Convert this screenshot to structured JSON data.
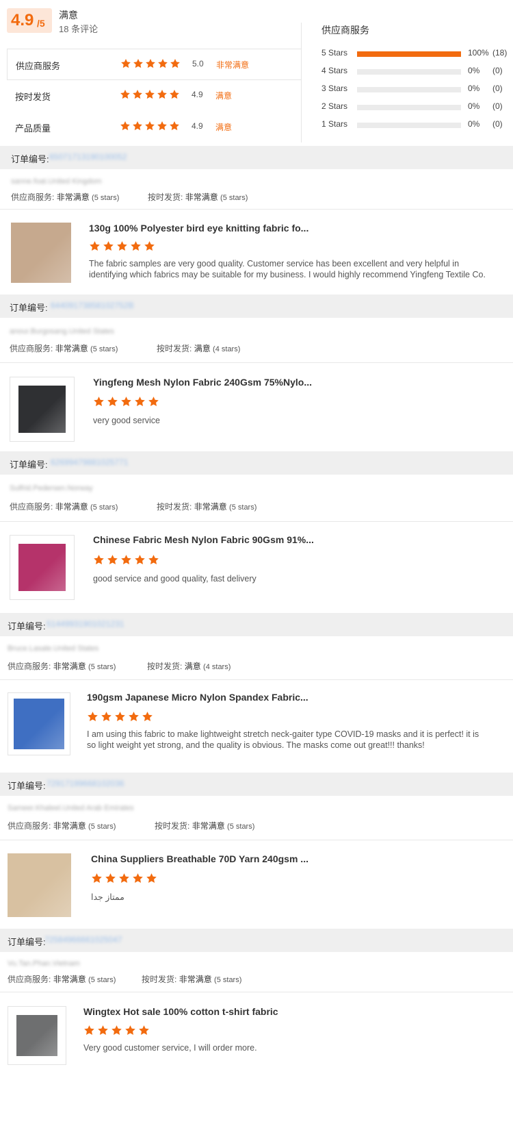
{
  "colors": {
    "accent": "#f26b0f",
    "bar_bg": "#ebebeb",
    "order_bg": "#efefef"
  },
  "summary": {
    "score": "4.9",
    "score_max": "/5",
    "satisfaction_label": "满意",
    "review_count_text": "18 条评论",
    "metrics": [
      {
        "label": "供应商服务",
        "stars": 5,
        "score": "5.0",
        "level": "非常满意"
      },
      {
        "label": "按时发货",
        "stars": 5,
        "score": "4.9",
        "level": "满意"
      },
      {
        "label": "产品质量",
        "stars": 5,
        "score": "4.9",
        "level": "满意"
      }
    ],
    "distribution_title": "供应商服务",
    "distribution": [
      {
        "label": "5  Stars",
        "percent": 100,
        "percent_text": "100%",
        "count_text": "(18)"
      },
      {
        "label": "4  Stars",
        "percent": 0,
        "percent_text": "0%",
        "count_text": "(0)"
      },
      {
        "label": "3  Stars",
        "percent": 0,
        "percent_text": "0%",
        "count_text": "(0)"
      },
      {
        "label": "2  Stars",
        "percent": 0,
        "percent_text": "0%",
        "count_text": "(0)"
      },
      {
        "label": "1  Stars",
        "percent": 0,
        "percent_text": "0%",
        "count_text": "(0)"
      }
    ]
  },
  "reviews": [
    {
      "order_label": "订单编号:",
      "order_number": "65071713190100052",
      "buyer": "sanne.foat.United Kingdom",
      "svc_label": "供应商服务:",
      "svc_value": "非常满意",
      "svc_stars": "(5 stars)",
      "ship_label": "按时发货:",
      "ship_value": "非常满意",
      "ship_stars": "(5 stars)",
      "product_title": "130g 100% Polyester bird eye knitting fabric fo...",
      "product_stars": 5,
      "comment": "The fabric samples are very good quality. Customer service has been excellent and very helpful in identifying which fabrics may be suitable for my business. I would highly recommend Yingfeng Textile Co.",
      "image_color": "#c6a98e"
    },
    {
      "order_label": "订单编号:",
      "order_number": "64409173858102752B",
      "buyer": "anour.Burgosang.United States",
      "svc_label": "供应商服务:",
      "svc_value": "非常满意",
      "svc_stars": "(5 stars)",
      "ship_label": "按时发货:",
      "ship_value": "满意",
      "ship_stars": "(4 stars)",
      "product_title": "Yingfeng Mesh Nylon Fabric 240Gsm 75%Nylo...",
      "product_stars": 5,
      "comment": "very good service",
      "image_color": "#2f3033"
    },
    {
      "order_label": "订单编号:",
      "order_number": "62699479881025771",
      "buyer": "Sulfrid.Pedersen.Norway",
      "svc_label": "供应商服务:",
      "svc_value": "非常满意",
      "svc_stars": "(5 stars)",
      "ship_label": "按时发货:",
      "ship_value": "非常满意",
      "ship_stars": "(5 stars)",
      "product_title": "Chinese Fabric Mesh Nylon Fabric 90Gsm 91%...",
      "product_stars": 5,
      "comment": "good service and good quality, fast delivery",
      "image_color": "#b5336a"
    },
    {
      "order_label": "订单编号:",
      "order_number": "51449931901021231",
      "buyer": "Bruce.Lasale.United States",
      "svc_label": "供应商服务:",
      "svc_value": "非常满意",
      "svc_stars": "(5 stars)",
      "ship_label": "按时发货:",
      "ship_value": "满意",
      "ship_stars": "(4 stars)",
      "product_title": "190gsm Japanese Micro Nylon Spandex Fabric...",
      "product_stars": 5,
      "comment": "I am using this fabric to make lightweight stretch neck-gaiter type COVID-19 masks and it is perfect!  it is so light weight yet strong, and the quality is obvious.  The masks come out great!!!  thanks!",
      "image_color": "#3f6fc2"
    },
    {
      "order_label": "订单编号:",
      "order_number": "72917199668102036",
      "buyer": "Sameer.Khaleel.United Arab Emirates",
      "svc_label": "供应商服务:",
      "svc_value": "非常满意",
      "svc_stars": "(5 stars)",
      "ship_label": "按时发货:",
      "ship_value": "非常满意",
      "ship_stars": "(5 stars)",
      "product_title": "China Suppliers Breathable 70D Yarn 240gsm ...",
      "product_stars": 5,
      "comment": "ممتاز جدا",
      "image_color": "#d8c1a1"
    },
    {
      "order_label": "订单编号:",
      "order_number": "72584966661025047",
      "buyer": "Vu.Tan.Phan.Vietnam",
      "svc_label": "供应商服务:",
      "svc_value": "非常满意",
      "svc_stars": "(5 stars)",
      "ship_label": "按时发货:",
      "ship_value": "非常满意",
      "ship_stars": "(5 stars)",
      "product_title": "Wingtex Hot sale 100% cotton t-shirt fabric",
      "product_stars": 5,
      "comment": "Very good customer service, I will order more.",
      "image_color": "#6e6f70"
    }
  ]
}
